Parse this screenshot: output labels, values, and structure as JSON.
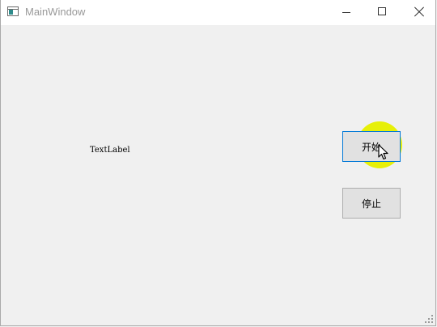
{
  "window": {
    "title": "MainWindow",
    "controls": {
      "minimize": "minimize-icon",
      "maximize": "maximize-icon",
      "close": "close-icon"
    }
  },
  "main": {
    "text_label": "TextLabel",
    "start_button": "开始",
    "stop_button": "停止"
  },
  "colors": {
    "background": "#f0f0f0",
    "focus_border": "#0078d7",
    "cursor_highlight": "#e6f000"
  }
}
